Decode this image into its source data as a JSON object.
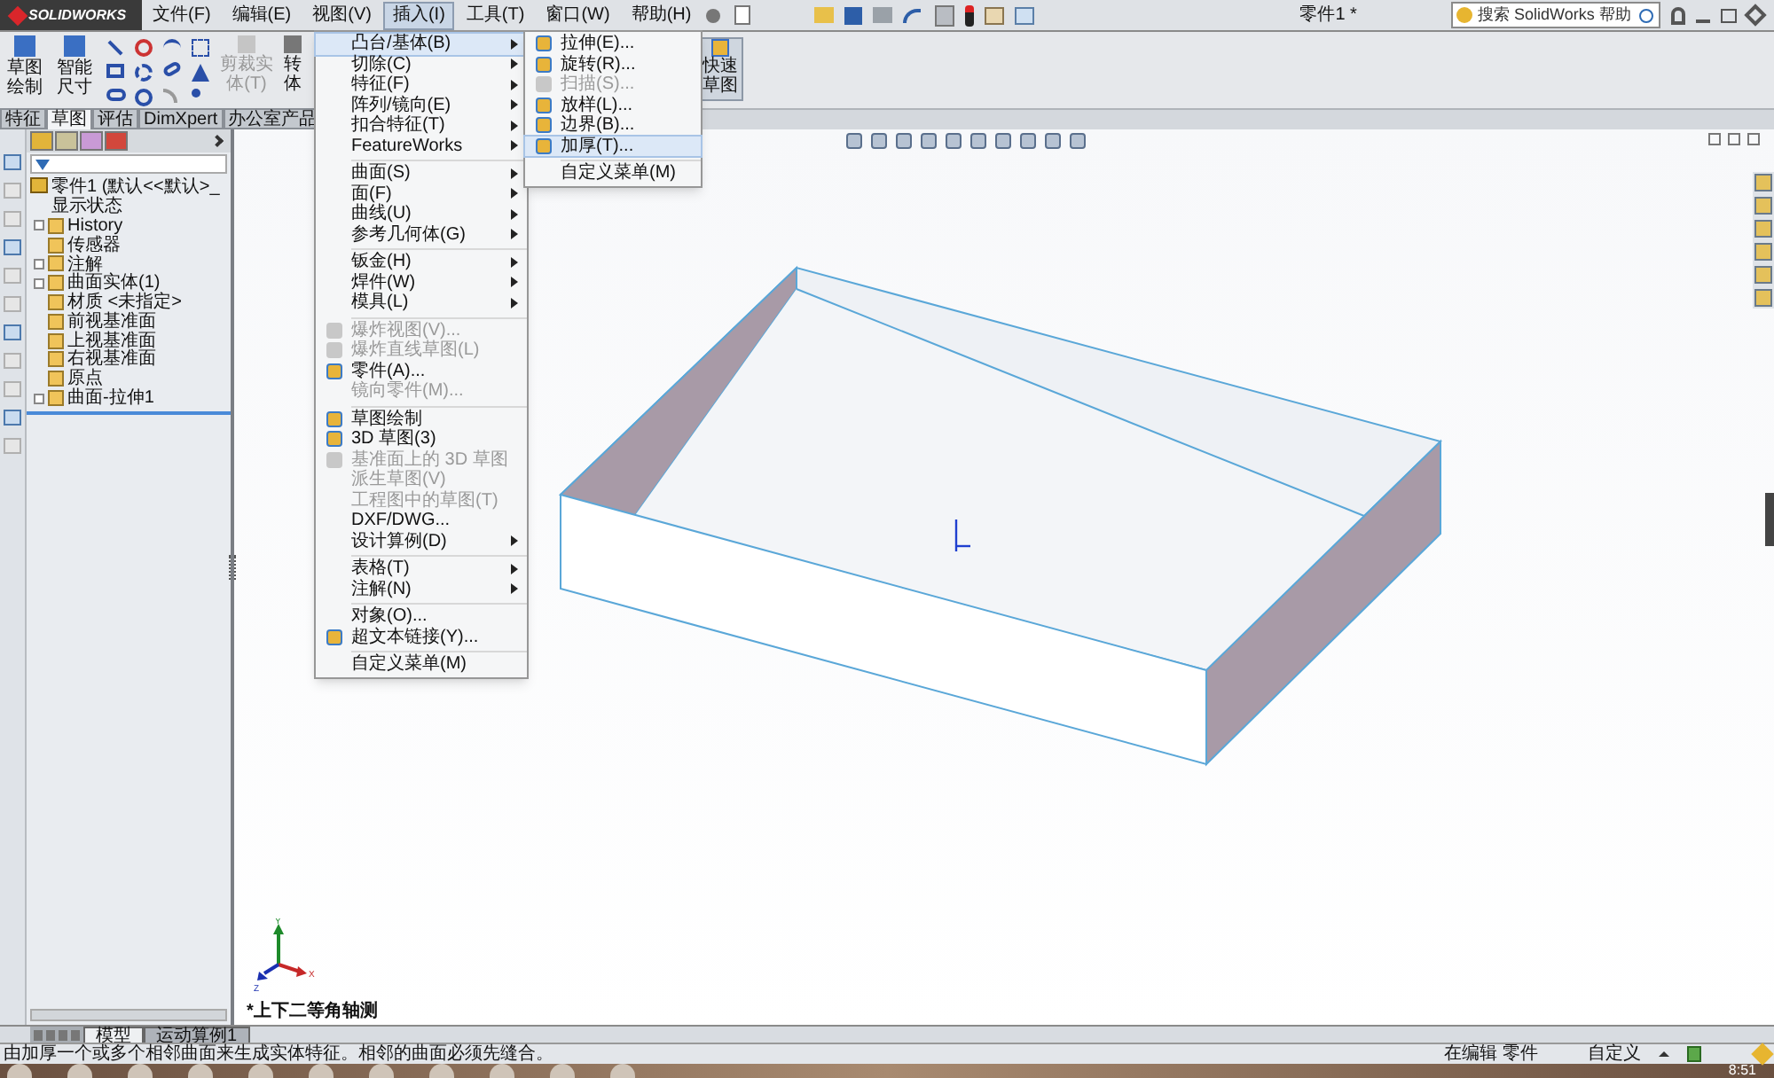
{
  "app": {
    "logo": "SOLIDWORKS",
    "document_title": "零件1 *",
    "search": {
      "placeholder": "搜索 SolidWorks 帮助"
    },
    "menu": [
      {
        "label": "文件(F)",
        "selected": false
      },
      {
        "label": "编辑(E)",
        "selected": false
      },
      {
        "label": "视图(V)",
        "selected": false
      },
      {
        "label": "插入(I)",
        "selected": true
      },
      {
        "label": "工具(T)",
        "selected": false
      },
      {
        "label": "窗口(W)",
        "selected": false
      },
      {
        "label": "帮助(H)",
        "selected": false
      }
    ]
  },
  "ribbon": {
    "buttons": [
      {
        "label": "草图绘制",
        "disabled": false
      },
      {
        "label": "智能尺寸",
        "disabled": false
      },
      {
        "label": "剪裁实体(T)",
        "disabled": true
      },
      {
        "label": "转体",
        "disabled": false
      }
    ],
    "quick_sketch": {
      "label": "快速草图"
    }
  },
  "command_tabs": [
    {
      "label": "特征",
      "selected": false
    },
    {
      "label": "草图",
      "selected": true
    },
    {
      "label": "评估",
      "selected": false
    },
    {
      "label": "DimXpert",
      "selected": false
    },
    {
      "label": "办公室产品",
      "selected": false
    }
  ],
  "feature_tree": {
    "root": "零件1 (默认<<默认>_显示状态",
    "children": [
      {
        "label": "History",
        "kind": "collapsed"
      },
      {
        "label": "传感器",
        "kind": "leaf"
      },
      {
        "label": "注解",
        "kind": "collapsed"
      },
      {
        "label": "曲面实体(1)",
        "kind": "collapsed"
      },
      {
        "label": "材质 <未指定>",
        "kind": "leaf"
      },
      {
        "label": "前视基准面",
        "kind": "leaf"
      },
      {
        "label": "上视基准面",
        "kind": "leaf"
      },
      {
        "label": "右视基准面",
        "kind": "leaf"
      },
      {
        "label": "原点",
        "kind": "leaf"
      },
      {
        "label": "曲面-拉伸1",
        "kind": "collapsed"
      }
    ]
  },
  "insert_menu": {
    "items": [
      {
        "kind": "item",
        "label": "凸台/基体(B)",
        "submenu": true,
        "disabled": false,
        "selected": true,
        "icon": false
      },
      {
        "kind": "item",
        "label": "切除(C)",
        "submenu": true,
        "disabled": false,
        "selected": false,
        "icon": false
      },
      {
        "kind": "item",
        "label": "特征(F)",
        "submenu": true,
        "disabled": false,
        "selected": false,
        "icon": false
      },
      {
        "kind": "item",
        "label": "阵列/镜向(E)",
        "submenu": true,
        "disabled": false,
        "selected": false,
        "icon": false
      },
      {
        "kind": "item",
        "label": "扣合特征(T)",
        "submenu": true,
        "disabled": false,
        "selected": false,
        "icon": false
      },
      {
        "kind": "item",
        "label": "FeatureWorks",
        "submenu": true,
        "disabled": false,
        "selected": false,
        "icon": false
      },
      {
        "kind": "separator"
      },
      {
        "kind": "item",
        "label": "曲面(S)",
        "submenu": true,
        "disabled": false,
        "selected": false,
        "icon": false
      },
      {
        "kind": "item",
        "label": "面(F)",
        "submenu": true,
        "disabled": false,
        "selected": false,
        "icon": false
      },
      {
        "kind": "item",
        "label": "曲线(U)",
        "submenu": true,
        "disabled": false,
        "selected": false,
        "icon": false
      },
      {
        "kind": "item",
        "label": "参考几何体(G)",
        "submenu": true,
        "disabled": false,
        "selected": false,
        "icon": false
      },
      {
        "kind": "separator"
      },
      {
        "kind": "item",
        "label": "钣金(H)",
        "submenu": true,
        "disabled": false,
        "selected": false,
        "icon": false
      },
      {
        "kind": "item",
        "label": "焊件(W)",
        "submenu": true,
        "disabled": false,
        "selected": false,
        "icon": false
      },
      {
        "kind": "item",
        "label": "模具(L)",
        "submenu": true,
        "disabled": false,
        "selected": false,
        "icon": false
      },
      {
        "kind": "separator"
      },
      {
        "kind": "item",
        "label": "爆炸视图(V)...",
        "submenu": false,
        "disabled": true,
        "selected": false,
        "icon": true
      },
      {
        "kind": "item",
        "label": "爆炸直线草图(L)",
        "submenu": false,
        "disabled": true,
        "selected": false,
        "icon": true
      },
      {
        "kind": "item",
        "label": "零件(A)...",
        "submenu": false,
        "disabled": false,
        "selected": false,
        "icon": true
      },
      {
        "kind": "item",
        "label": "镜向零件(M)...",
        "submenu": false,
        "disabled": true,
        "selected": false,
        "icon": false
      },
      {
        "kind": "separator"
      },
      {
        "kind": "item",
        "label": "草图绘制",
        "submenu": false,
        "disabled": false,
        "selected": false,
        "icon": true
      },
      {
        "kind": "item",
        "label": "3D 草图(3)",
        "submenu": false,
        "disabled": false,
        "selected": false,
        "icon": true
      },
      {
        "kind": "item",
        "label": "基准面上的 3D 草图",
        "submenu": false,
        "disabled": true,
        "selected": false,
        "icon": true
      },
      {
        "kind": "item",
        "label": "派生草图(V)",
        "submenu": false,
        "disabled": true,
        "selected": false,
        "icon": false
      },
      {
        "kind": "item",
        "label": "工程图中的草图(T)",
        "submenu": false,
        "disabled": true,
        "selected": false,
        "icon": false
      },
      {
        "kind": "item",
        "label": "DXF/DWG...",
        "submenu": false,
        "disabled": false,
        "selected": false,
        "icon": false
      },
      {
        "kind": "item",
        "label": "设计算例(D)",
        "submenu": true,
        "disabled": false,
        "selected": false,
        "icon": false
      },
      {
        "kind": "separator"
      },
      {
        "kind": "item",
        "label": "表格(T)",
        "submenu": true,
        "disabled": false,
        "selected": false,
        "icon": false
      },
      {
        "kind": "item",
        "label": "注解(N)",
        "submenu": true,
        "disabled": false,
        "selected": false,
        "icon": false
      },
      {
        "kind": "separator"
      },
      {
        "kind": "item",
        "label": "对象(O)...",
        "submenu": false,
        "disabled": false,
        "selected": false,
        "icon": false
      },
      {
        "kind": "item",
        "label": "超文本链接(Y)...",
        "submenu": false,
        "disabled": false,
        "selected": false,
        "icon": true
      },
      {
        "kind": "separator"
      },
      {
        "kind": "item",
        "label": "自定义菜单(M)",
        "submenu": false,
        "disabled": false,
        "selected": false,
        "icon": false
      }
    ]
  },
  "boss_submenu": {
    "items": [
      {
        "kind": "item",
        "label": "拉伸(E)...",
        "disabled": false,
        "selected": false,
        "icon": true
      },
      {
        "kind": "item",
        "label": "旋转(R)...",
        "disabled": false,
        "selected": false,
        "icon": true
      },
      {
        "kind": "item",
        "label": "扫描(S)...",
        "disabled": true,
        "selected": false,
        "icon": true
      },
      {
        "kind": "item",
        "label": "放样(L)...",
        "disabled": false,
        "selected": false,
        "icon": true
      },
      {
        "kind": "item",
        "label": "边界(B)...",
        "disabled": false,
        "selected": false,
        "icon": true
      },
      {
        "kind": "item",
        "label": "加厚(T)...",
        "disabled": false,
        "selected": true,
        "icon": true
      },
      {
        "kind": "separator"
      },
      {
        "kind": "item",
        "label": "自定义菜单(M)",
        "disabled": false,
        "selected": false,
        "icon": false
      }
    ]
  },
  "viewport": {
    "view_label": "*上下二等角轴测",
    "triad": {
      "y": "Y",
      "x": "X",
      "z": "Z"
    }
  },
  "bottom_tabs": [
    {
      "label": "模型",
      "selected": true
    },
    {
      "label": "运动算例1",
      "selected": false
    }
  ],
  "status_bar": {
    "message": "由加厚一个或多个相邻曲面来生成实体特征。相邻的曲面必须先缝合。",
    "mode": "在编辑 零件",
    "units": "自定义"
  },
  "taskbar": {
    "clock": "8:51"
  }
}
